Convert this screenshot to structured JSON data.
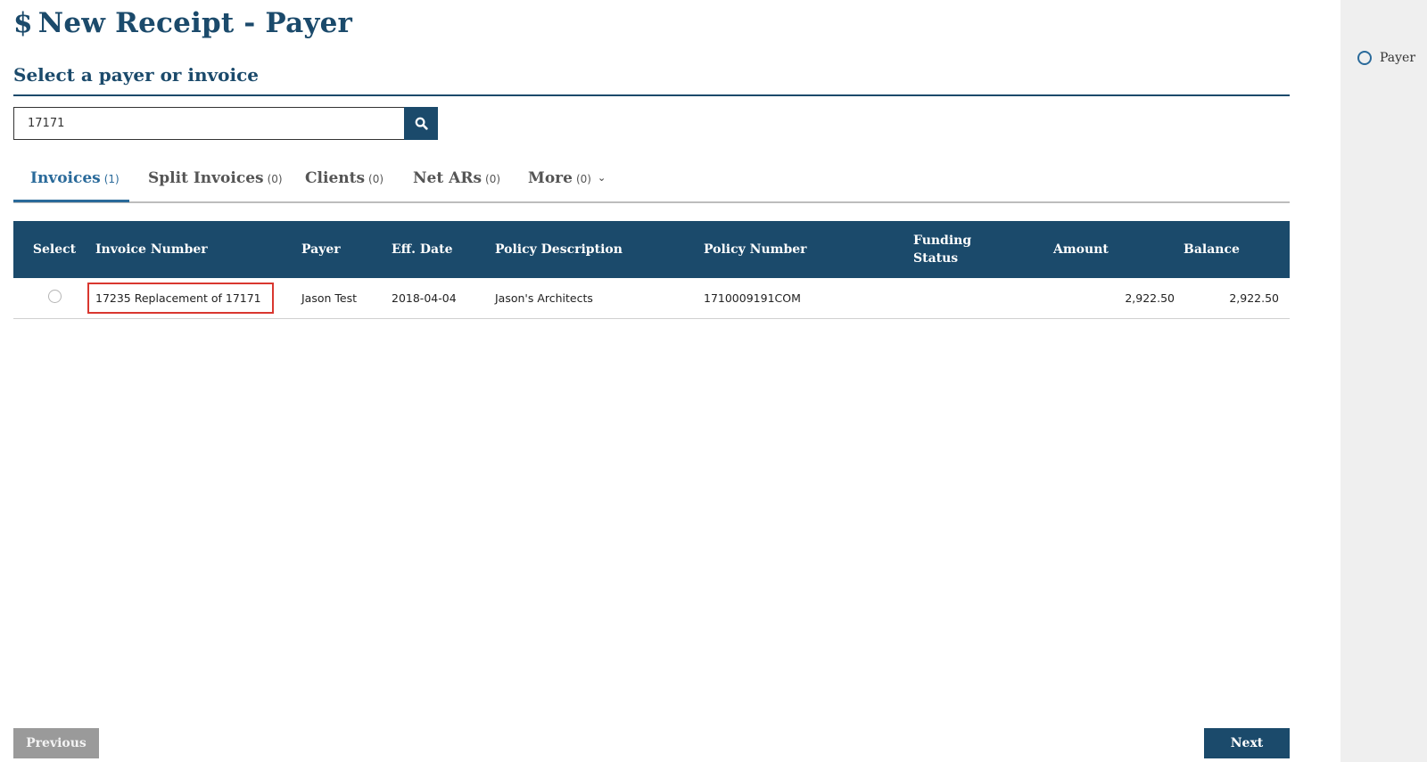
{
  "header": {
    "icon": "dollar-icon",
    "dollar": "$",
    "title": "New Receipt - Payer"
  },
  "section": {
    "subtitle": "Select a payer or invoice"
  },
  "search": {
    "value": "17171",
    "button_icon": "search-icon"
  },
  "tabs": [
    {
      "label": "Invoices",
      "count": "(1)",
      "active": true
    },
    {
      "label": "Split Invoices",
      "count": "(0)",
      "active": false
    },
    {
      "label": "Clients",
      "count": "(0)",
      "active": false
    },
    {
      "label": "Net ARs",
      "count": "(0)",
      "active": false
    },
    {
      "label": "More",
      "count": "(0)",
      "active": false,
      "icon": "chevron-down-icon"
    }
  ],
  "table": {
    "columns": {
      "select": "Select",
      "invoice_number": "Invoice Number",
      "payer": "Payer",
      "eff_date": "Eff. Date",
      "policy_description": "Policy Description",
      "policy_number": "Policy Number",
      "funding_status_line1": "Funding",
      "funding_status_line2": "Status",
      "amount": "Amount",
      "balance": "Balance"
    },
    "rows": [
      {
        "selected": false,
        "invoice_number": "17235 Replacement of 17171",
        "payer": "Jason Test",
        "eff_date": "2018-04-04",
        "policy_description": "Jason's Architects",
        "policy_number": "1710009191COM",
        "funding_status": "",
        "amount": "2,922.50",
        "balance": "2,922.50"
      }
    ]
  },
  "footer": {
    "previous_label": "Previous",
    "next_label": "Next"
  },
  "sidebar": {
    "steps": [
      {
        "label": "Payer",
        "icon": "step-circle-icon"
      }
    ]
  },
  "colors": {
    "primary": "#1b4a6b",
    "accent": "#2a6a9a",
    "highlight": "#d9372f",
    "sidebar_bg": "#efefef",
    "disabled_button": "#9a9a9a"
  }
}
